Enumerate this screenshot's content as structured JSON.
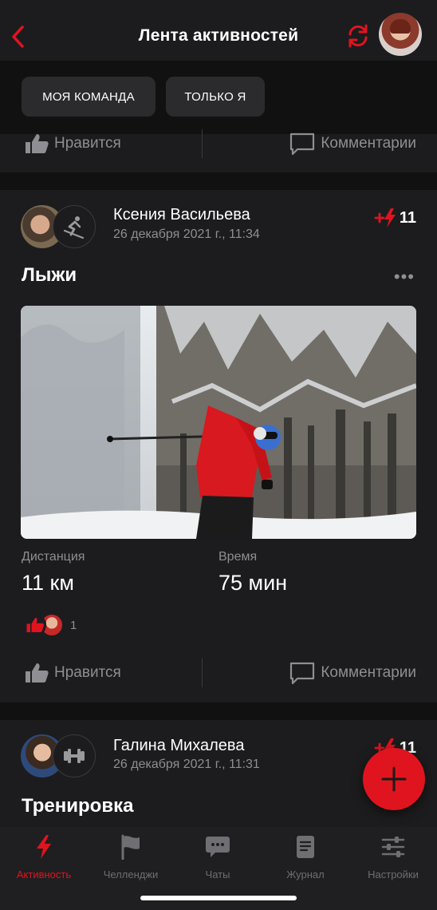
{
  "header": {
    "title": "Лента активностей",
    "back_icon": "chevron-left-icon",
    "sync_icon": "refresh-icon",
    "accent_color": "#e0141e"
  },
  "filters": [
    {
      "label": "МОЯ КОМАНДА"
    },
    {
      "label": "ТОЛЬКО Я"
    }
  ],
  "prev_post": {
    "like_label": "Нравится",
    "comment_label": "Комментарии"
  },
  "post": {
    "user_name": "Ксения Васильева",
    "date": "26 декабря 2021 г., 11:34",
    "score": "11",
    "activity_title": "Лыжи",
    "more": "•••",
    "stats": [
      {
        "label": "Дистанция",
        "value": "11 км"
      },
      {
        "label": "Время",
        "value": "75 мин"
      }
    ],
    "likes_count": "1",
    "like_label": "Нравится",
    "comment_label": "Комментарии"
  },
  "next_post": {
    "user_name": "Галина Михалева",
    "date": "26 декабря 2021 г., 11:31",
    "score": "11",
    "activity_title": "Тренировка"
  },
  "fab": {
    "icon": "plus-icon"
  },
  "tabs": [
    {
      "label": "Активность",
      "icon": "lightning-icon",
      "active": true
    },
    {
      "label": "Челленджи",
      "icon": "flag-icon",
      "active": false
    },
    {
      "label": "Чаты",
      "icon": "chat-icon",
      "active": false
    },
    {
      "label": "Журнал",
      "icon": "journal-icon",
      "active": false
    },
    {
      "label": "Настройки",
      "icon": "sliders-icon",
      "active": false
    }
  ]
}
